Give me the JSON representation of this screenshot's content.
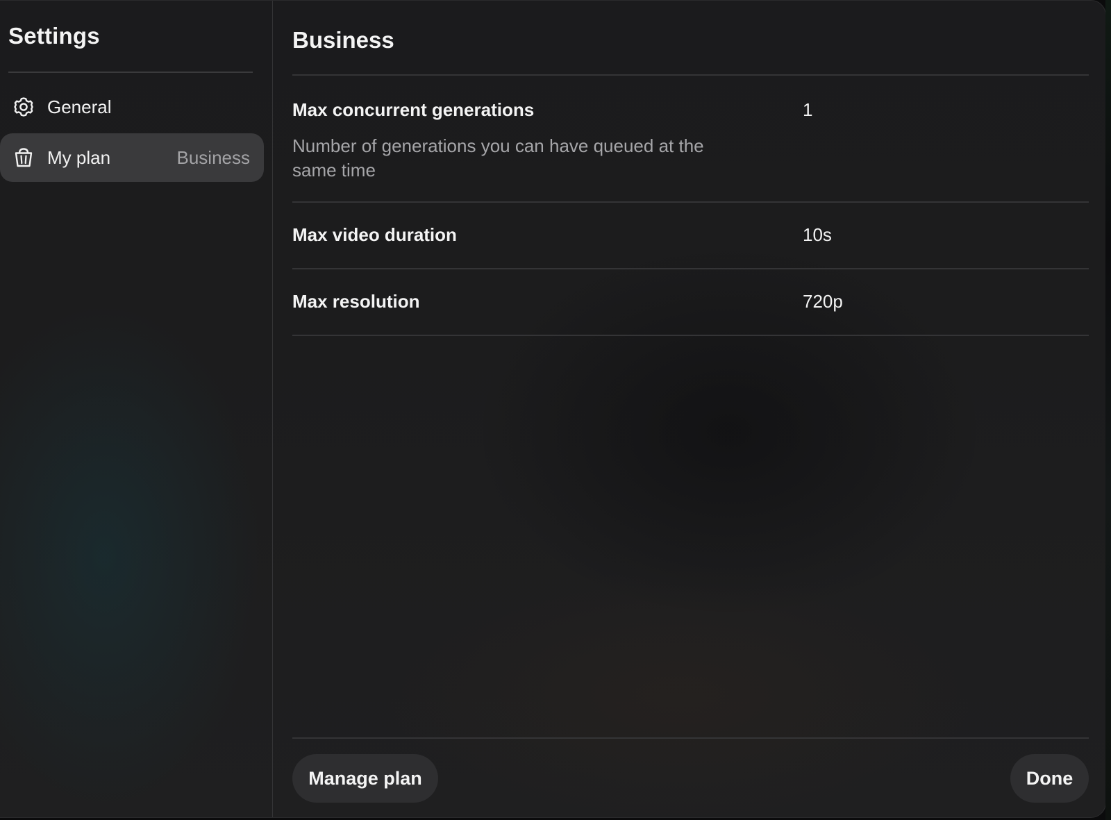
{
  "sidebar": {
    "title": "Settings",
    "items": [
      {
        "label": "General",
        "icon": "gear-icon",
        "badge": "",
        "active": false
      },
      {
        "label": "My plan",
        "icon": "basket-icon",
        "badge": "Business",
        "active": true
      }
    ]
  },
  "main": {
    "title": "Business",
    "rows": [
      {
        "label": "Max concurrent generations",
        "value": "1",
        "description": "Number of generations you can have queued at the same time"
      },
      {
        "label": "Max video duration",
        "value": "10s"
      },
      {
        "label": "Max resolution",
        "value": "720p"
      }
    ]
  },
  "footer": {
    "manage_label": "Manage plan",
    "done_label": "Done"
  },
  "colors": {
    "background": "#1c1c1d",
    "active_item": "#3a3a3c",
    "button": "#2e2e30",
    "muted_text": "#a6a6a9"
  }
}
